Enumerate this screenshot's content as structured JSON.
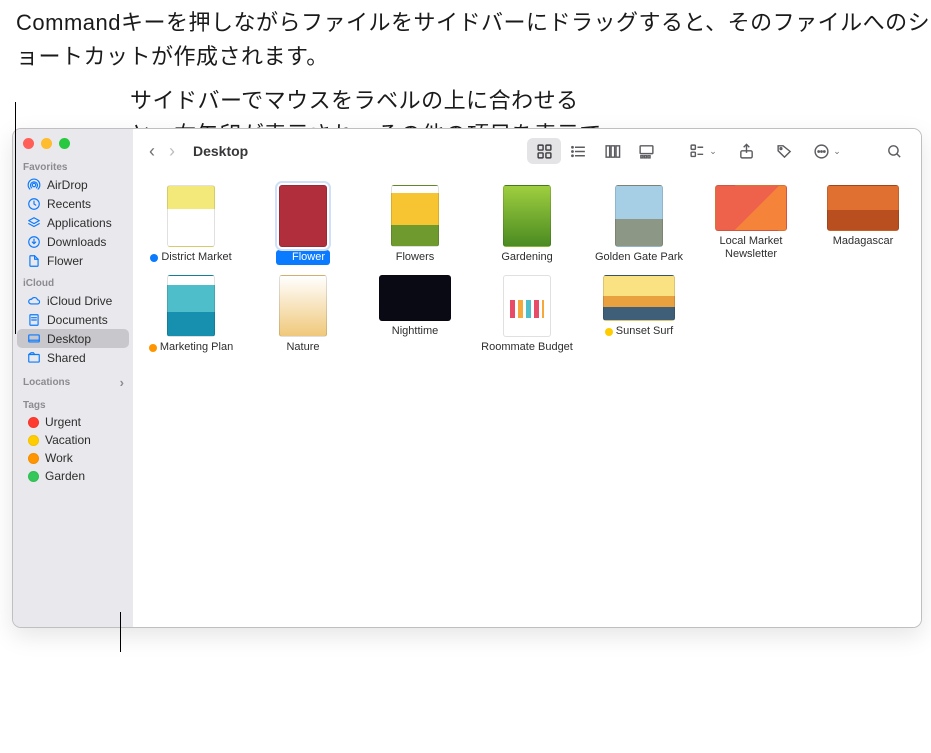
{
  "annotations": {
    "top": "Commandキーを押しながらファイルをサイドバーにドラッグすると、そのファイルへのショートカットが作成されます。",
    "bottom": "サイドバーでマウスをラベルの上に合わせると、右矢印が表示され、その他の項目を表示できるようになります。"
  },
  "colors": {
    "accent": "#0a7aff",
    "tag_red": "#ff3b30",
    "tag_yellow": "#ffcc00",
    "tag_orange": "#ff9500",
    "tag_green": "#34c759",
    "tag_blue": "#0a7aff"
  },
  "toolbar": {
    "title": "Desktop"
  },
  "sidebar": {
    "favorites_label": "Favorites",
    "favorites": [
      {
        "name": "AirDrop",
        "icon": "airdrop"
      },
      {
        "name": "Recents",
        "icon": "clock"
      },
      {
        "name": "Applications",
        "icon": "apps"
      },
      {
        "name": "Downloads",
        "icon": "download"
      },
      {
        "name": "Flower",
        "icon": "file"
      }
    ],
    "icloud_label": "iCloud",
    "icloud": [
      {
        "name": "iCloud Drive",
        "icon": "cloud"
      },
      {
        "name": "Documents",
        "icon": "doc"
      },
      {
        "name": "Desktop",
        "icon": "desktop",
        "selected": true
      },
      {
        "name": "Shared",
        "icon": "shared"
      }
    ],
    "locations_label": "Locations",
    "tags_label": "Tags",
    "tags": [
      {
        "name": "Urgent",
        "color": "#ff3b30"
      },
      {
        "name": "Vacation",
        "color": "#ffcc00"
      },
      {
        "name": "Work",
        "color": "#ff9500"
      },
      {
        "name": "Garden",
        "color": "#34c759"
      }
    ]
  },
  "files": [
    {
      "name": "District Market",
      "thumb": "t-district",
      "tag": "#0a7aff"
    },
    {
      "name": "Flower",
      "thumb": "t-flower",
      "tag": "#0a7aff",
      "selected": true
    },
    {
      "name": "Flowers",
      "thumb": "t-flowers"
    },
    {
      "name": "Gardening",
      "thumb": "t-garden"
    },
    {
      "name": "Golden Gate Park",
      "thumb": "t-ggp"
    },
    {
      "name": "Local Market Newsletter",
      "thumb": "t-news",
      "landscape": true
    },
    {
      "name": "Madagascar",
      "thumb": "t-mada",
      "landscape": true
    },
    {
      "name": "Marketing Plan",
      "thumb": "t-mktg",
      "tag": "#ff9500"
    },
    {
      "name": "Nature",
      "thumb": "t-nature"
    },
    {
      "name": "Nighttime",
      "thumb": "t-night",
      "landscape": true
    },
    {
      "name": "Roommate Budget",
      "thumb": "t-budget"
    },
    {
      "name": "Sunset Surf",
      "thumb": "t-sunset",
      "landscape": true,
      "tag": "#ffcc00"
    }
  ]
}
